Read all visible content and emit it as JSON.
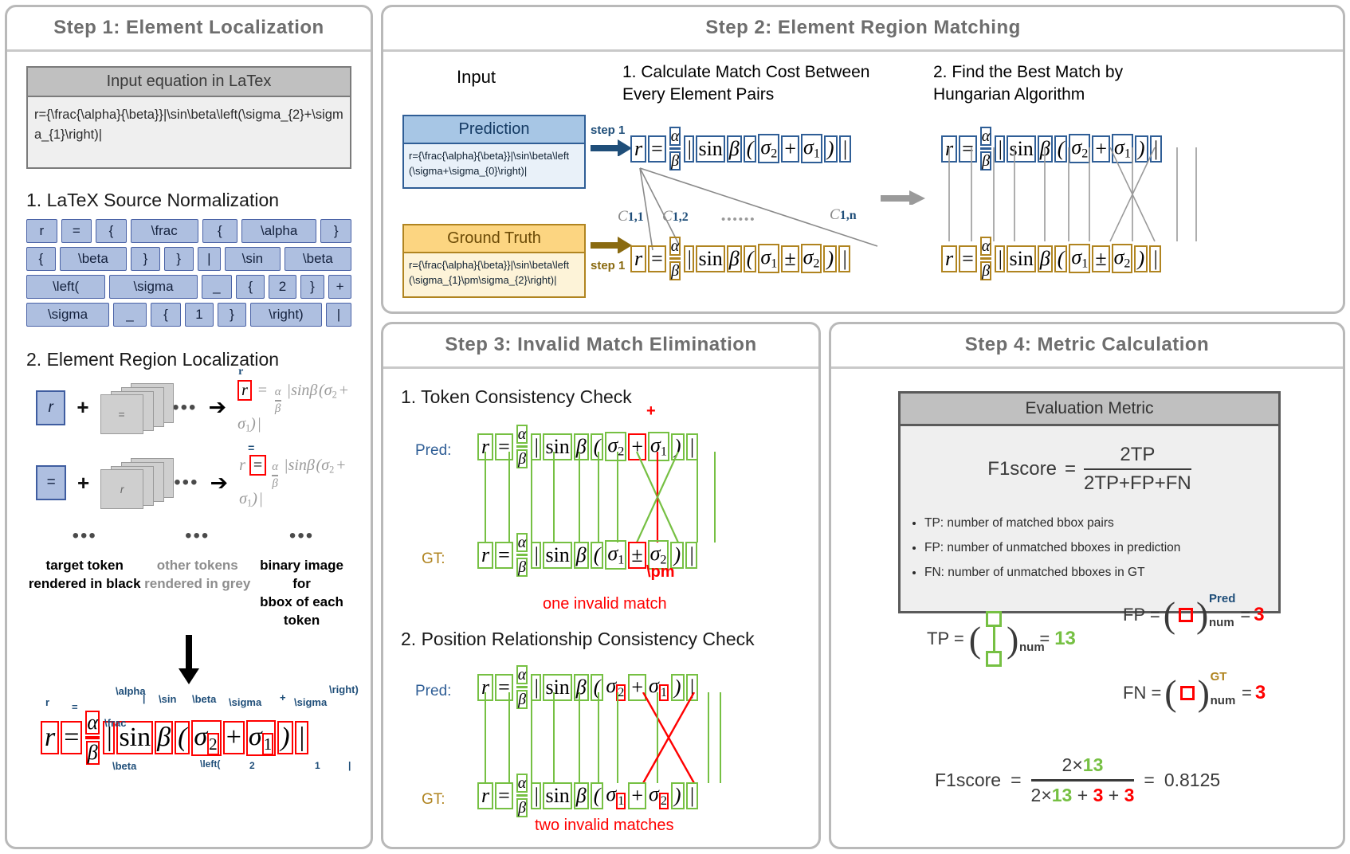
{
  "step1": {
    "title": "Step 1: Element Localization",
    "input_card": {
      "header": "Input equation in LaTex",
      "latex": "r={\\frac{\\alpha}{\\beta}}|\\sin\\beta\\left(\\sigma_{2}+\\sigma_{1}\\right)|"
    },
    "sub1_title": "1. LaTeX Source Normalization",
    "tokens": [
      [
        "r",
        "=",
        "{",
        "\\frac",
        "{",
        "\\alpha",
        "}"
      ],
      [
        "{",
        "\\beta",
        "}",
        "}",
        "|",
        "\\sin",
        "\\beta"
      ],
      [
        "\\left(",
        "\\sigma",
        "_",
        "{",
        "2",
        "}",
        "+"
      ],
      [
        "\\sigma",
        "_",
        "{",
        "1",
        "}",
        "\\right)",
        "|"
      ]
    ],
    "sub2_title": "2. Element Region Localization",
    "examples": [
      {
        "target": "r",
        "other": "=",
        "focus": "r"
      },
      {
        "target": "=",
        "other": "r",
        "focus": "="
      }
    ],
    "ellipsis": "•••",
    "captions": [
      "target token\nrendered in black",
      "other tokens\nrendered in grey",
      "binary image for\nbbox of each token"
    ],
    "final_labels": [
      "r",
      "=",
      "\\alpha",
      "\\frac",
      "\\beta",
      "\\sin",
      "\\beta",
      "\\sigma",
      "+",
      "\\sigma",
      "\\right)",
      "\\left(",
      "|",
      "2",
      "1",
      "|"
    ]
  },
  "step2": {
    "title": "Step 2: Element Region Matching",
    "input_label": "Input",
    "col1_title": "1. Calculate Match Cost Between\nEvery Element Pairs",
    "col2_title": "2. Find the Best Match by\nHungarian Algorithm",
    "prediction": {
      "header": "Prediction",
      "latex": "r={\\frac{\\alpha}{\\beta}}|\\sin\\beta\\left(\\sigma+\\sigma_{0}\\right)|"
    },
    "ground_truth": {
      "header": "Ground Truth",
      "latex": "r={\\frac{\\alpha}{\\beta}}|\\sin\\beta\\left(\\sigma_{1}\\pm\\sigma_{2}\\right)|"
    },
    "step_arrow_label": "step 1",
    "costs": [
      "C",
      "1,1",
      "1,2",
      "1,n"
    ],
    "cost_ellipsis": "••••••"
  },
  "step3": {
    "title": "Step 3: Invalid Match Elimination",
    "sub1_title": "1. Token Consistency Check",
    "sub2_title": "2. Position Relationship Consistency Check",
    "pred_label": "Pred:",
    "gt_label": "GT:",
    "annot_plus": "+",
    "annot_pm": "\\pm",
    "note1": "one invalid match",
    "note2": "two invalid matches"
  },
  "step4": {
    "title": "Step 4: Metric Calculation",
    "card_header": "Evaluation Metric",
    "formula": {
      "name": "F1score",
      "eq": "=",
      "numerator": "2TP",
      "denominator": "2TP+FP+FN"
    },
    "bullets": [
      "TP:  number of matched bbox pairs",
      "FP: number of unmatched bboxes in prediction",
      "FN: number of unmatched bboxes in GT"
    ],
    "tp": {
      "label": "TP =",
      "sub": "num",
      "eq": "=",
      "value": "13"
    },
    "fp": {
      "label": "FP =",
      "sup": "Pred",
      "sub": "num",
      "eq": "=",
      "value": "3"
    },
    "fn": {
      "label": "FN =",
      "sup": "GT",
      "sub": "num",
      "eq": "=",
      "value": "3"
    },
    "result": {
      "name": "F1score",
      "eq": "=",
      "num_left": "2×",
      "num_val": "13",
      "den_left": "2×",
      "den_val": "13",
      "den_plus1": "+",
      "den_fp": "3",
      "den_plus2": "+",
      "den_fn": "3",
      "eq2": "=",
      "value": "0.8125"
    }
  },
  "colors": {
    "blue": "#2f5e96",
    "gold": "#b08420",
    "green": "#76c043",
    "red": "#ff0000",
    "grey_title": "#6e6e6e"
  }
}
